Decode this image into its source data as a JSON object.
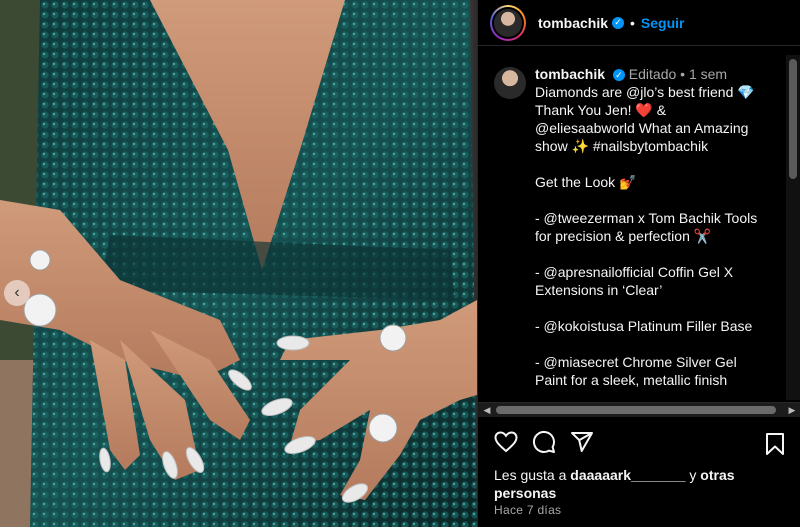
{
  "post": {
    "username": "tombachik",
    "follow_label": "Seguir",
    "separator": "•"
  },
  "caption": {
    "username": "tombachik",
    "edited": "Editado",
    "time_ago": "1 sem",
    "lines": [
      "Diamonds are @jlo’s best friend 💎",
      "Thank You Jen! ❤️ &",
      "@eliesaabworld What an Amazing",
      "show ✨ #nailsbytombachik",
      "",
      "Get the Look 💅",
      "",
      "- @tweezerman x Tom Bachik Tools",
      "for precision & perfection ✂️",
      "",
      "- @apresnailofficial Coffin Gel X",
      "Extensions in ‘Clear’",
      "",
      "- @kokoistusa Platinum Filler Base",
      "",
      "- @miasecret Chrome Silver Gel",
      "Paint for a sleek, metallic finish"
    ]
  },
  "likes": {
    "prefix": "Les gusta a",
    "user": "daaaaark_______",
    "and": "y",
    "others": "otras personas"
  },
  "timestamp": "Hace 7 días",
  "icons": {
    "verified": "verified-badge-icon",
    "like": "heart-icon",
    "comment": "comment-icon",
    "share": "send-icon",
    "save": "bookmark-icon",
    "carousel_prev": "chevron-left-icon"
  },
  "colors": {
    "accent": "#0095f6",
    "background": "#000000",
    "secondary_text": "#a8a8a8"
  }
}
